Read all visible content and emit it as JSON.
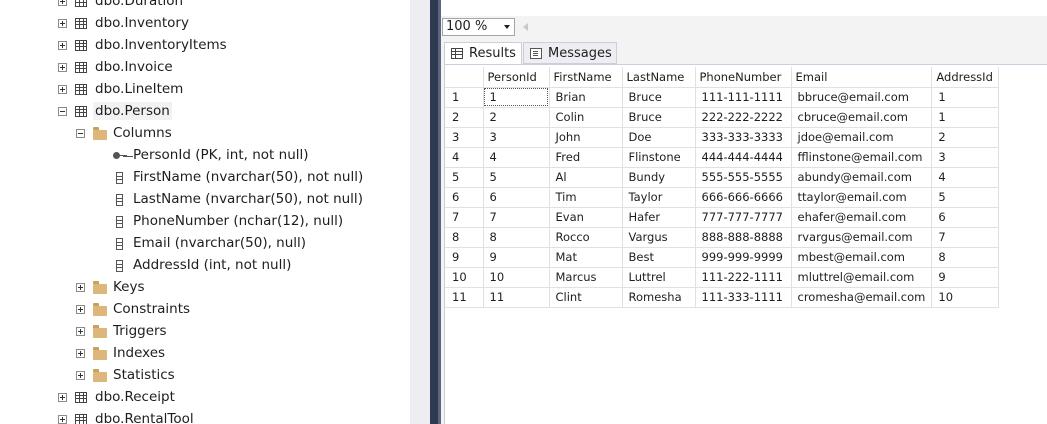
{
  "explorer": {
    "items": [
      {
        "label": "dbo.Duration",
        "type": "table",
        "level": 0,
        "expanded": false
      },
      {
        "label": "dbo.Inventory",
        "type": "table",
        "level": 0,
        "expanded": false
      },
      {
        "label": "dbo.InventoryItems",
        "type": "table",
        "level": 0,
        "expanded": false
      },
      {
        "label": "dbo.Invoice",
        "type": "table",
        "level": 0,
        "expanded": false
      },
      {
        "label": "dbo.LineItem",
        "type": "table",
        "level": 0,
        "expanded": false
      },
      {
        "label": "dbo.Person",
        "type": "table",
        "level": 0,
        "expanded": true
      },
      {
        "label": "Columns",
        "type": "folder",
        "level": 1,
        "expanded": true
      },
      {
        "label": "PersonId (PK, int, not null)",
        "type": "key-column",
        "level": 2
      },
      {
        "label": "FirstName (nvarchar(50), not null)",
        "type": "column",
        "level": 2
      },
      {
        "label": "LastName (nvarchar(50), not null)",
        "type": "column",
        "level": 2
      },
      {
        "label": "PhoneNumber (nchar(12), null)",
        "type": "column",
        "level": 2
      },
      {
        "label": "Email (nvarchar(50), null)",
        "type": "column",
        "level": 2
      },
      {
        "label": "AddressId (int, not null)",
        "type": "column",
        "level": 2
      },
      {
        "label": "Keys",
        "type": "folder",
        "level": 1,
        "expanded": false
      },
      {
        "label": "Constraints",
        "type": "folder",
        "level": 1,
        "expanded": false
      },
      {
        "label": "Triggers",
        "type": "folder",
        "level": 1,
        "expanded": false
      },
      {
        "label": "Indexes",
        "type": "folder",
        "level": 1,
        "expanded": false
      },
      {
        "label": "Statistics",
        "type": "folder",
        "level": 1,
        "expanded": false
      },
      {
        "label": "dbo.Receipt",
        "type": "table",
        "level": 0,
        "expanded": false
      },
      {
        "label": "dbo.RentalTool",
        "type": "table",
        "level": 0,
        "expanded": false
      }
    ]
  },
  "zoom": {
    "value": "100 %"
  },
  "tabs": {
    "results": "Results",
    "messages": "Messages"
  },
  "grid": {
    "columns": [
      "PersonId",
      "FirstName",
      "LastName",
      "PhoneNumber",
      "Email",
      "AddressId"
    ],
    "rows": [
      [
        "1",
        "1",
        "Brian",
        "Bruce",
        "111-111-1111",
        "bbruce@email.com",
        "1"
      ],
      [
        "2",
        "2",
        "Colin",
        "Bruce",
        "222-222-2222",
        "cbruce@email.com",
        "1"
      ],
      [
        "3",
        "3",
        "John",
        "Doe",
        "333-333-3333",
        "jdoe@email.com",
        "2"
      ],
      [
        "4",
        "4",
        "Fred",
        "Flinstone",
        "444-444-4444",
        "fflinstone@email.com",
        "3"
      ],
      [
        "5",
        "5",
        "Al",
        "Bundy",
        "555-555-5555",
        "abundy@email.com",
        "4"
      ],
      [
        "6",
        "6",
        "Tim",
        "Taylor",
        "666-666-6666",
        "ttaylor@email.com",
        "5"
      ],
      [
        "7",
        "7",
        "Evan",
        "Hafer",
        "777-777-7777",
        "ehafer@email.com",
        "6"
      ],
      [
        "8",
        "8",
        "Rocco",
        "Vargus",
        "888-888-8888",
        "rvargus@email.com",
        "7"
      ],
      [
        "9",
        "9",
        "Mat",
        "Best",
        "999-999-9999",
        "mbest@email.com",
        "8"
      ],
      [
        "10",
        "10",
        "Marcus",
        "Luttrel",
        "111-222-1111",
        "mluttrel@email.com",
        "9"
      ],
      [
        "11",
        "11",
        "Clint",
        "Romesha",
        "111-333-1111",
        "cromesha@email.com",
        "10"
      ]
    ]
  }
}
